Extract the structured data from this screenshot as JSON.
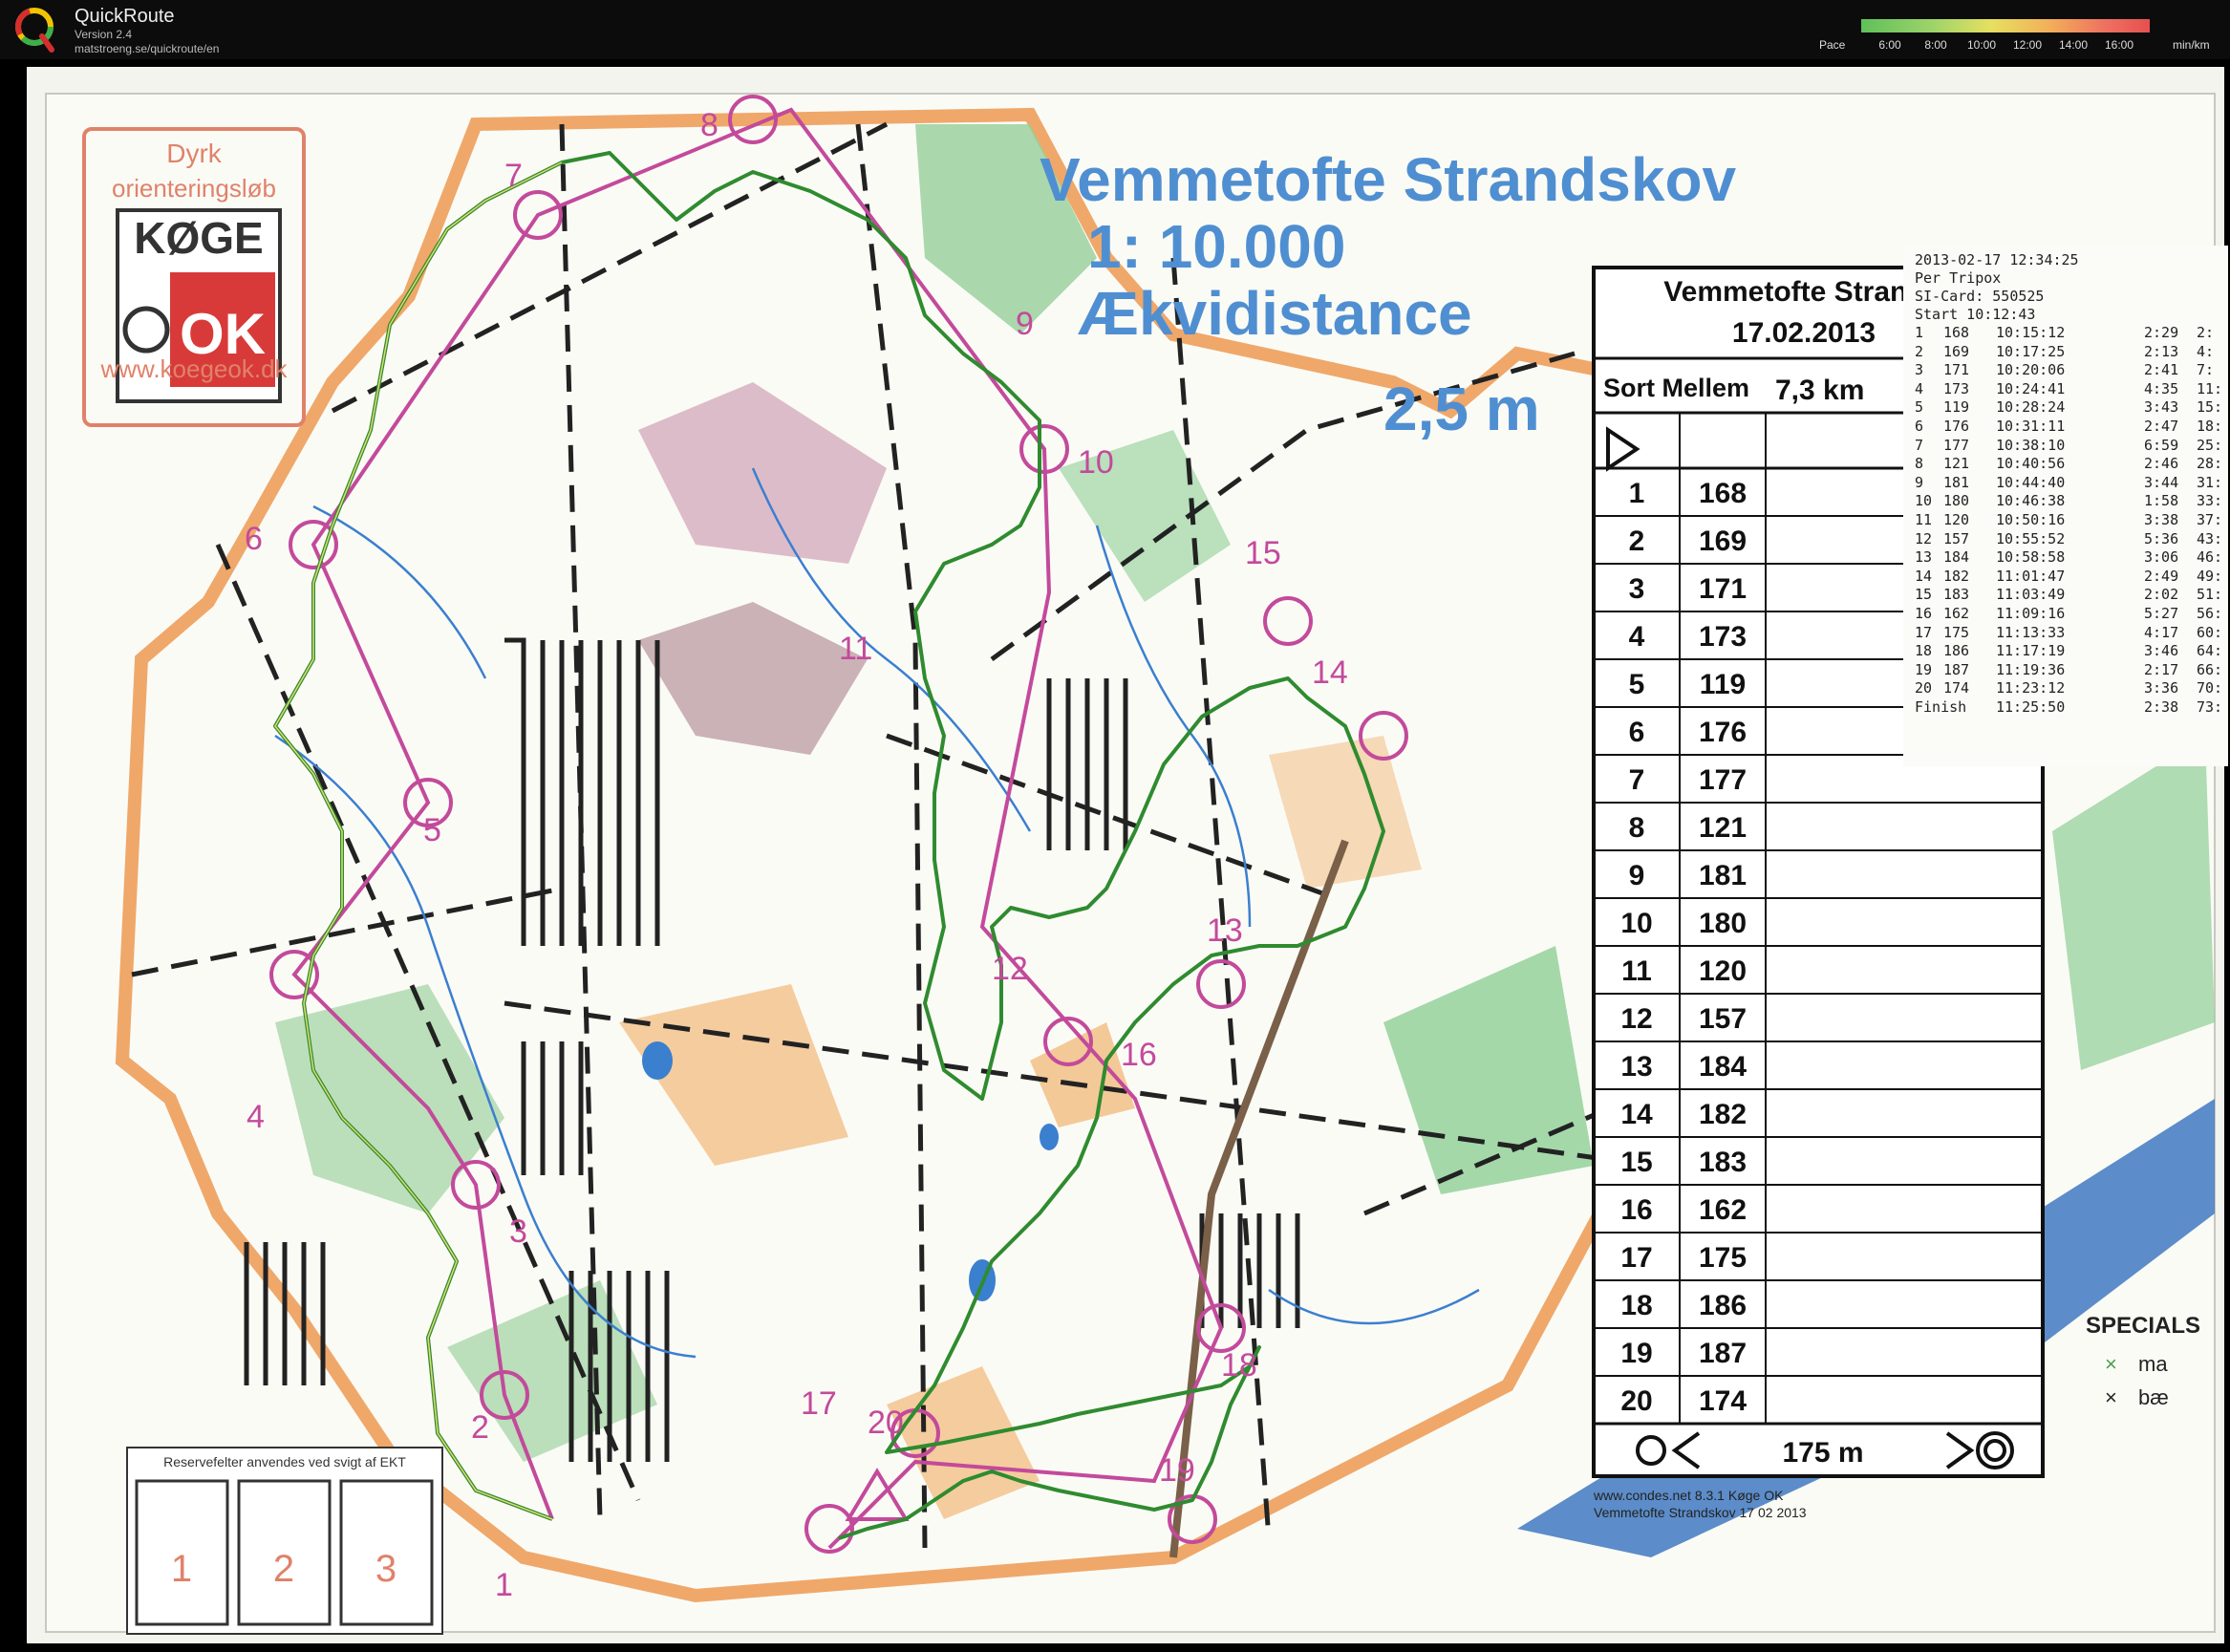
{
  "app": {
    "title": "QuickRoute",
    "version": "Version 2.4",
    "url": "matstroeng.se/quickroute/en",
    "logo_icon": "quickroute-q-logo"
  },
  "pace_legend": {
    "label": "Pace",
    "ticks": [
      "6:00",
      "8:00",
      "10:00",
      "12:00",
      "14:00",
      "16:00"
    ],
    "unit": "min/km"
  },
  "map": {
    "title": "Vemmetofte Strandskov",
    "scale": "1: 10.000",
    "equidistance_label": "Ækvidistance",
    "equidistance_value": "2,5 m",
    "club_logo": {
      "line1": "Dyrk",
      "line2": "orienteringsløb",
      "word1": "KØGE",
      "word2": "OK",
      "url": "www.koegeok.dk"
    },
    "reserve_label": "Reservefelter anvendes ved svigt af EKT",
    "reserve_boxes": [
      "1",
      "2",
      "3"
    ],
    "specials_title": "SPECIALS",
    "specials_items": [
      "ma",
      "bæ"
    ],
    "footer1": "www.condes.net 8.3.1 Køge OK",
    "footer2": "Vemmetofte Strandskov 17 02 2013",
    "control_numbers": [
      "1",
      "2",
      "3",
      "4",
      "5",
      "6",
      "7",
      "8",
      "9",
      "10",
      "11",
      "12",
      "13",
      "14",
      "15",
      "16",
      "17",
      "18",
      "19",
      "20"
    ]
  },
  "descriptions": {
    "event": "Vemmetofte Strand",
    "date": "17.02.2013",
    "course": "Sort Mellem",
    "length": "7,3 km",
    "rows": [
      {
        "n": "1",
        "code": "168"
      },
      {
        "n": "2",
        "code": "169"
      },
      {
        "n": "3",
        "code": "171"
      },
      {
        "n": "4",
        "code": "173"
      },
      {
        "n": "5",
        "code": "119"
      },
      {
        "n": "6",
        "code": "176"
      },
      {
        "n": "7",
        "code": "177"
      },
      {
        "n": "8",
        "code": "121"
      },
      {
        "n": "9",
        "code": "181"
      },
      {
        "n": "10",
        "code": "180"
      },
      {
        "n": "11",
        "code": "120"
      },
      {
        "n": "12",
        "code": "157"
      },
      {
        "n": "13",
        "code": "184"
      },
      {
        "n": "14",
        "code": "182"
      },
      {
        "n": "15",
        "code": "183"
      },
      {
        "n": "16",
        "code": "162"
      },
      {
        "n": "17",
        "code": "175"
      },
      {
        "n": "18",
        "code": "186"
      },
      {
        "n": "19",
        "code": "187"
      },
      {
        "n": "20",
        "code": "174"
      }
    ],
    "finish_distance": "175 m"
  },
  "split_card": {
    "timestamp": "2013-02-17  12:34:25",
    "name": "Per    Tripox",
    "si_card": "SI-Card:   550525",
    "start": "Start     10:12:43",
    "rows": [
      {
        "n": "1",
        "code": "168",
        "time": "10:15:12",
        "split": "2:29",
        "cum": "2:"
      },
      {
        "n": "2",
        "code": "169",
        "time": "10:17:25",
        "split": "2:13",
        "cum": "4:"
      },
      {
        "n": "3",
        "code": "171",
        "time": "10:20:06",
        "split": "2:41",
        "cum": "7:"
      },
      {
        "n": "4",
        "code": "173",
        "time": "10:24:41",
        "split": "4:35",
        "cum": "11:"
      },
      {
        "n": "5",
        "code": "119",
        "time": "10:28:24",
        "split": "3:43",
        "cum": "15:"
      },
      {
        "n": "6",
        "code": "176",
        "time": "10:31:11",
        "split": "2:47",
        "cum": "18:"
      },
      {
        "n": "7",
        "code": "177",
        "time": "10:38:10",
        "split": "6:59",
        "cum": "25:"
      },
      {
        "n": "8",
        "code": "121",
        "time": "10:40:56",
        "split": "2:46",
        "cum": "28:"
      },
      {
        "n": "9",
        "code": "181",
        "time": "10:44:40",
        "split": "3:44",
        "cum": "31:"
      },
      {
        "n": "10",
        "code": "180",
        "time": "10:46:38",
        "split": "1:58",
        "cum": "33:"
      },
      {
        "n": "11",
        "code": "120",
        "time": "10:50:16",
        "split": "3:38",
        "cum": "37:"
      },
      {
        "n": "12",
        "code": "157",
        "time": "10:55:52",
        "split": "5:36",
        "cum": "43:"
      },
      {
        "n": "13",
        "code": "184",
        "time": "10:58:58",
        "split": "3:06",
        "cum": "46:"
      },
      {
        "n": "14",
        "code": "182",
        "time": "11:01:47",
        "split": "2:49",
        "cum": "49:"
      },
      {
        "n": "15",
        "code": "183",
        "time": "11:03:49",
        "split": "2:02",
        "cum": "51:"
      },
      {
        "n": "16",
        "code": "162",
        "time": "11:09:16",
        "split": "5:27",
        "cum": "56:"
      },
      {
        "n": "17",
        "code": "175",
        "time": "11:13:33",
        "split": "4:17",
        "cum": "60:"
      },
      {
        "n": "18",
        "code": "186",
        "time": "11:17:19",
        "split": "3:46",
        "cum": "64:"
      },
      {
        "n": "19",
        "code": "187",
        "time": "11:19:36",
        "split": "2:17",
        "cum": "66:"
      },
      {
        "n": "20",
        "code": "174",
        "time": "11:23:12",
        "split": "3:36",
        "cum": "70:"
      }
    ],
    "finish": {
      "label": "Finish",
      "time": "11:25:50",
      "split": "2:38",
      "cum": "73:"
    }
  },
  "colors": {
    "map_bg": "#fbfbf6",
    "forest_green": "#8fcf96",
    "open_orange": "#f3c38e",
    "course_purple": "#c34a9b",
    "water_blue": "#3b7fcf",
    "route_green": "#2f8b2f",
    "title_blue": "#4f8fd1"
  }
}
